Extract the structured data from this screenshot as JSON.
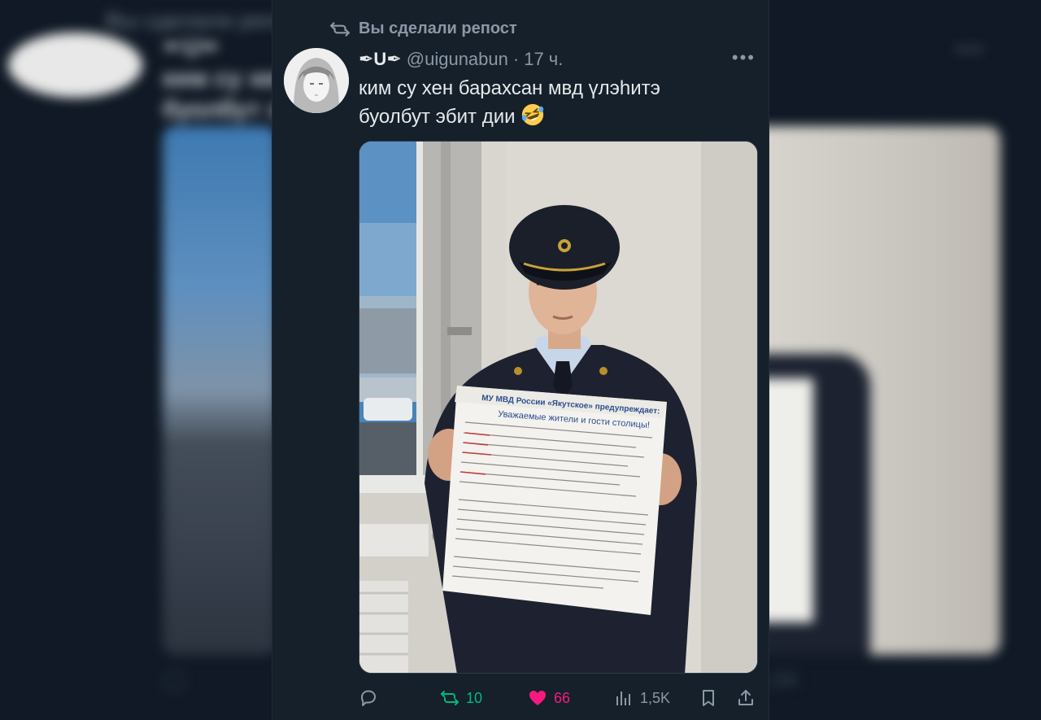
{
  "repost_banner": {
    "label": "Вы сделали репост"
  },
  "tweet": {
    "display_name": "✒U✒",
    "handle": "@uigunabun",
    "separator": "·",
    "time": "17 ч.",
    "text_line1": "ким су хен барахсан мвд үлэhитэ",
    "text_line2": "буолбут эбит дии",
    "emoji": "rofl-emoji"
  },
  "poster": {
    "header": "МУ МВД России «Якутское» предупреждает:",
    "subheader": "Уважаемые жители и гости столицы!"
  },
  "actions": {
    "reply_count": "",
    "retweet_count": "10",
    "like_count": "66",
    "views_count": "1,5K"
  },
  "colors": {
    "background": "#15202b",
    "retweet": "#00ba7c",
    "like": "#f91880",
    "muted": "#8b98a5"
  }
}
